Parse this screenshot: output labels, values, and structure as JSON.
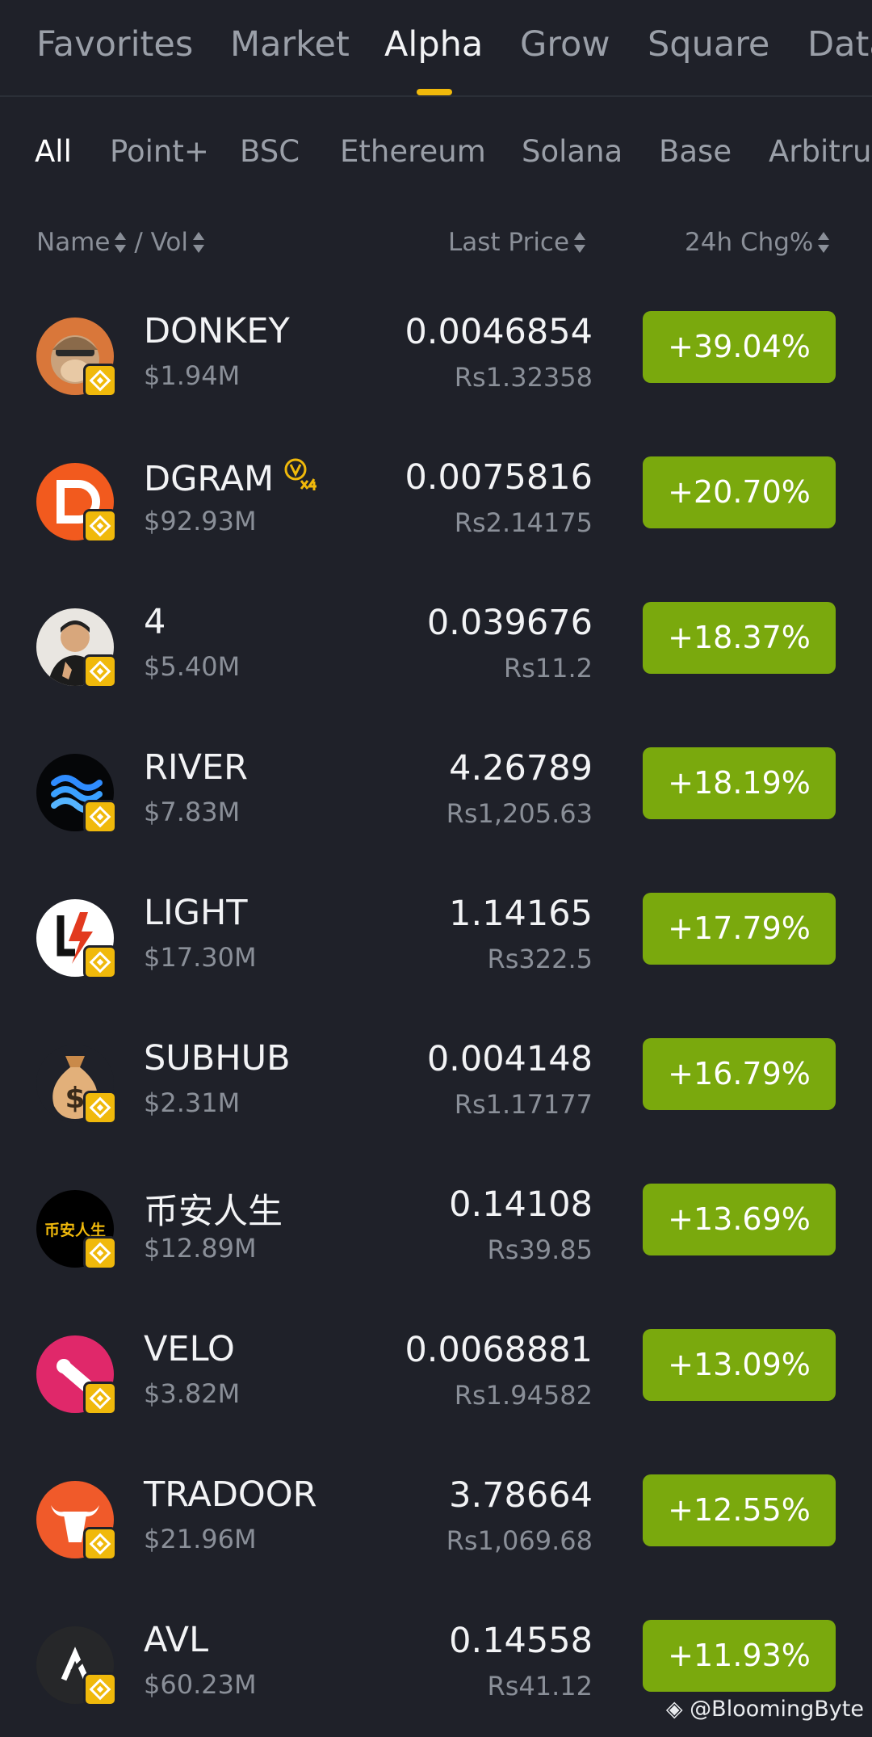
{
  "top_tabs": [
    "Favorites",
    "Market",
    "Alpha",
    "Grow",
    "Square",
    "Data"
  ],
  "active_tab": "Alpha",
  "chips": [
    "All",
    "Point+",
    "BSC",
    "Ethereum",
    "Solana",
    "Base",
    "Arbitrum"
  ],
  "active_chip": "All",
  "columns": {
    "name": "Name",
    "vol": "/ Vol",
    "last_price": "Last Price",
    "change": "24h Chg%"
  },
  "rows": [
    {
      "symbol": "DONKEY",
      "vol": "$1.94M",
      "price": "0.0046854",
      "fiat": "Rs1.32358",
      "change": "+39.04%",
      "icon": "donkey-avatar-icon"
    },
    {
      "symbol": "DGRAM",
      "vol": "$92.93M",
      "price": "0.0075816",
      "fiat": "Rs2.14175",
      "change": "+20.70%",
      "icon": "dgram-logo-icon",
      "badge": "vx4-multiplier-icon"
    },
    {
      "symbol": "4",
      "vol": "$5.40M",
      "price": "0.039676",
      "fiat": "Rs11.2",
      "change": "+18.37%",
      "icon": "person-avatar-icon"
    },
    {
      "symbol": "RIVER",
      "vol": "$7.83M",
      "price": "4.26789",
      "fiat": "Rs1,205.63",
      "change": "+18.19%",
      "icon": "river-waves-icon"
    },
    {
      "symbol": "LIGHT",
      "vol": "$17.30M",
      "price": "1.14165",
      "fiat": "Rs322.5",
      "change": "+17.79%",
      "icon": "lightning-logo-icon"
    },
    {
      "symbol": "SUBHUB",
      "vol": "$2.31M",
      "price": "0.004148",
      "fiat": "Rs1.17177",
      "change": "+16.79%",
      "icon": "money-bag-icon"
    },
    {
      "symbol": "币安人生",
      "vol": "$12.89M",
      "price": "0.14108",
      "fiat": "Rs39.85",
      "change": "+13.69%",
      "icon": "binance-life-logo-icon",
      "logo_text": "币安人生"
    },
    {
      "symbol": "VELO",
      "vol": "$3.82M",
      "price": "0.0068881",
      "fiat": "Rs1.94582",
      "change": "+13.09%",
      "icon": "velo-logo-icon"
    },
    {
      "symbol": "TRADOOR",
      "vol": "$21.96M",
      "price": "3.78664",
      "fiat": "Rs1,069.68",
      "change": "+12.55%",
      "icon": "bull-head-icon"
    },
    {
      "symbol": "AVL",
      "vol": "$60.23M",
      "price": "0.14558",
      "fiat": "Rs41.12",
      "change": "+11.93%",
      "icon": "avl-logo-icon"
    }
  ],
  "watermark": "@BloomingByte",
  "colors": {
    "background": "#1f2129",
    "positive": "#7aa90d",
    "accent": "#f0b90b",
    "muted": "#8a8f98"
  }
}
